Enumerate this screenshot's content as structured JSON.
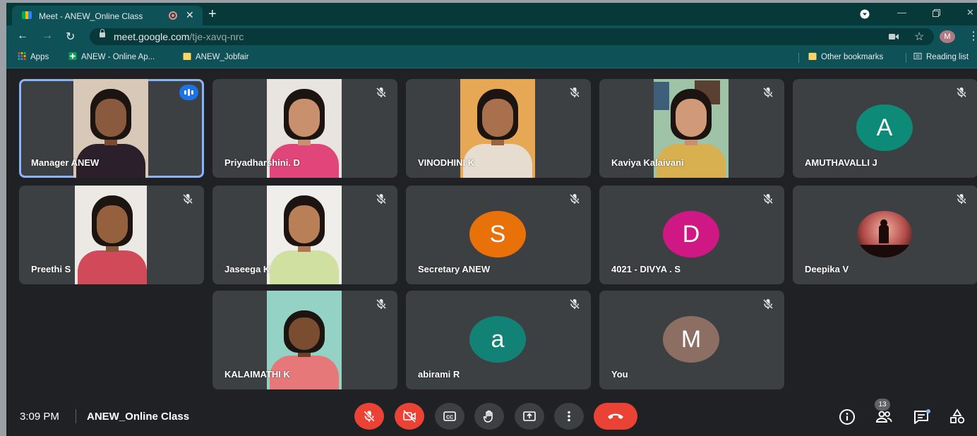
{
  "browser": {
    "tab_title": "Meet - ANEW_Online Class",
    "url_host": "meet.google.com",
    "url_path": "/tje-xavq-nrc",
    "profile_initial": "M",
    "bookmarks": {
      "apps": "Apps",
      "item1": "ANEW - Online Ap...",
      "item2": "ANEW_Jobfair",
      "other": "Other bookmarks",
      "reading": "Reading list"
    }
  },
  "participants": [
    {
      "name": "Manager ANEW",
      "type": "video",
      "speaking": true
    },
    {
      "name": "Priyadharshini. D",
      "type": "video",
      "muted": true
    },
    {
      "name": "VINODHINI K",
      "type": "video",
      "muted": true
    },
    {
      "name": "Kaviya Kalaivani",
      "type": "video",
      "muted": true
    },
    {
      "name": "AMUTHAVALLI J",
      "type": "avatar",
      "initial": "A",
      "color": "#0e8a78",
      "muted": true
    },
    {
      "name": "Preethi S",
      "type": "video",
      "muted": true
    },
    {
      "name": "Jaseega K",
      "type": "video",
      "muted": true
    },
    {
      "name": "Secretary ANEW",
      "type": "avatar",
      "initial": "S",
      "color": "#e8710a",
      "muted": true
    },
    {
      "name": "4021 - DIVYA . S",
      "type": "avatar",
      "initial": "D",
      "color": "#d01884",
      "muted": true
    },
    {
      "name": "Deepika V",
      "type": "photo",
      "muted": true
    },
    {
      "name": "KALAIMATHI K",
      "type": "video",
      "muted": true
    },
    {
      "name": "abirami R",
      "type": "avatar",
      "initial": "a",
      "color": "#128277",
      "muted": true
    },
    {
      "name": "You",
      "type": "avatar",
      "initial": "M",
      "color": "#8d6e63",
      "muted": true
    }
  ],
  "footer": {
    "time": "3:09 PM",
    "meeting_name": "ANEW_Online Class",
    "participant_count": "13"
  },
  "colors": {
    "accent": "#8ab4f8",
    "danger": "#ea4335",
    "tile": "#3c4043",
    "background": "#202124"
  }
}
